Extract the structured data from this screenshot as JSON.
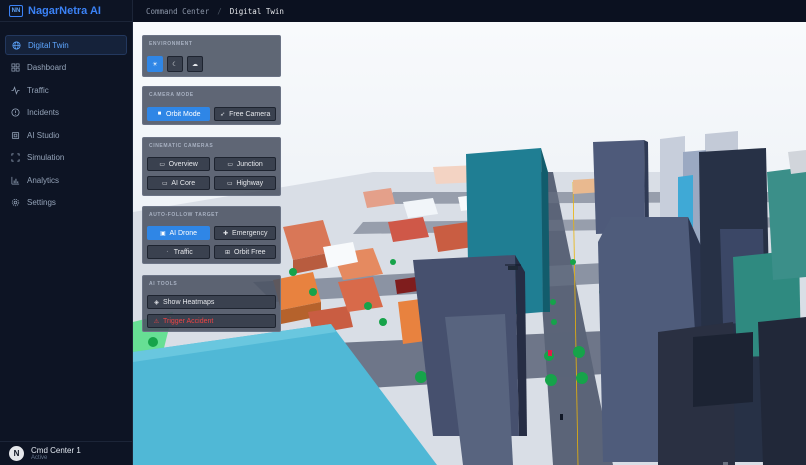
{
  "app": {
    "name": "NagarNetra AI",
    "logo": "NN"
  },
  "breadcrumb": {
    "parent": "Command Center",
    "separator": "/",
    "current": "Digital Twin"
  },
  "sidebar": {
    "items": [
      {
        "label": "Digital Twin",
        "icon": "globe-icon",
        "active": true
      },
      {
        "label": "Dashboard",
        "icon": "grid-icon"
      },
      {
        "label": "Traffic",
        "icon": "activity-icon"
      },
      {
        "label": "Incidents",
        "icon": "alert-circle-icon"
      },
      {
        "label": "AI Studio",
        "icon": "cpu-icon"
      },
      {
        "label": "Simulation",
        "icon": "scan-icon"
      },
      {
        "label": "Analytics",
        "icon": "bar-chart-icon"
      },
      {
        "label": "Settings",
        "icon": "gear-icon"
      }
    ],
    "footer": {
      "avatar": "N",
      "name": "Cmd Center 1",
      "status": "Active"
    }
  },
  "panels": {
    "environment": {
      "title": "ENVIRONMENT",
      "buttons": [
        "sun-icon",
        "moon-icon",
        "cloud-rain-icon"
      ],
      "active_index": 0
    },
    "camera_mode": {
      "title": "CAMERA MODE",
      "orbit": "Orbit Mode",
      "free": "Free Camera"
    },
    "cinematic": {
      "title": "CINEMATIC CAMERAS",
      "buttons": [
        "Overview",
        "Junction",
        "AI Core",
        "Highway"
      ]
    },
    "follow": {
      "title": "AUTO-FOLLOW TARGET",
      "buttons": [
        "AI Drone",
        "Emergency",
        "Traffic",
        "Orbit Free"
      ]
    },
    "ai_tools": {
      "title": "AI TOOLS",
      "heatmaps": "Show Heatmaps",
      "accident": "Trigger Accident"
    }
  },
  "colors": {
    "accent": "#2f86e6",
    "brand": "#3b82f6",
    "danger": "#ef4444",
    "sky": "#f1f5f9"
  }
}
